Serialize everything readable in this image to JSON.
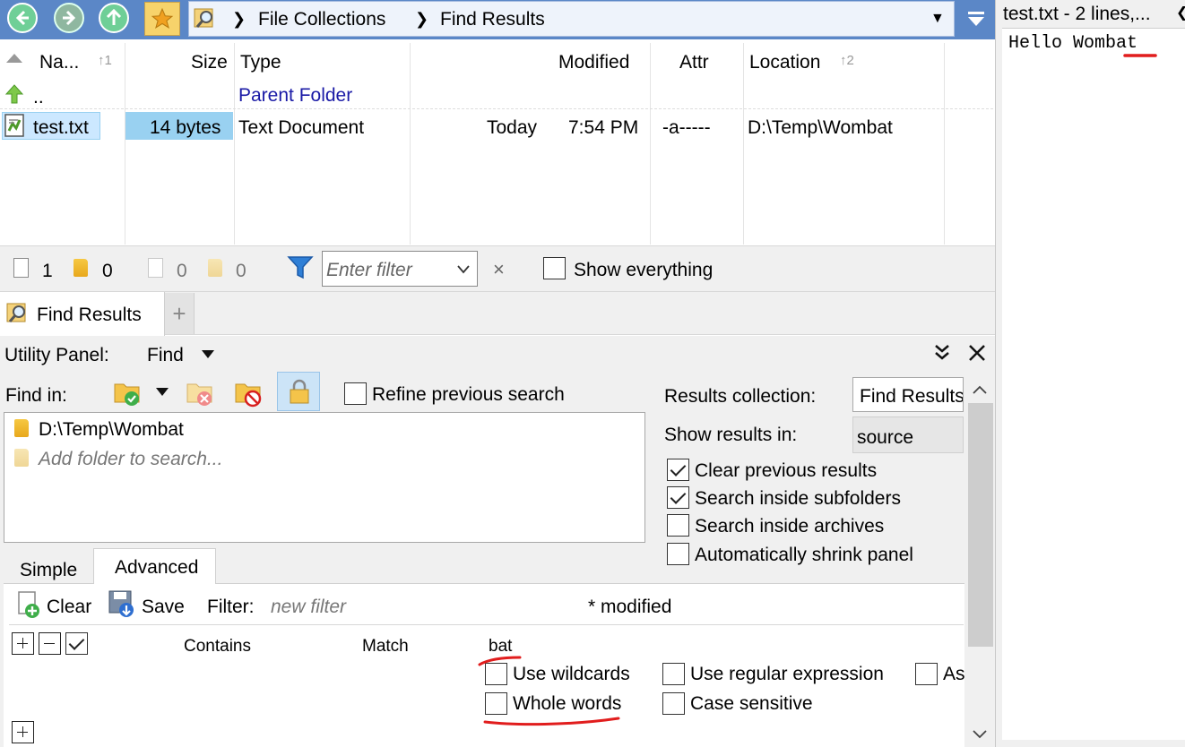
{
  "address_bar": {
    "crumbs": [
      "File Collections",
      "Find Results"
    ]
  },
  "file_list": {
    "columns": {
      "name": "Na...",
      "name_sort": "1",
      "size": "Size",
      "type": "Type",
      "modified": "Modified",
      "attr": "Attr",
      "location": "Location",
      "location_sort": "2"
    },
    "parent_row": {
      "name": "..",
      "type": "Parent Folder"
    },
    "rows": [
      {
        "name": "test.txt",
        "size": "14 bytes",
        "type": "Text Document",
        "modified_day": "Today",
        "modified_time": "7:54 PM",
        "attr": "-a-----",
        "location": "D:\\Temp\\Wombat"
      }
    ]
  },
  "status_bar": {
    "files_count": "1",
    "folders_count": "0",
    "sel_files_count": "0",
    "sel_folders_count": "0",
    "filter_placeholder": "Enter filter",
    "clear_filter": "×",
    "show_everything": "Show everything"
  },
  "tabs": {
    "active": "Find Results",
    "add": "+"
  },
  "utility_panel": {
    "label": "Utility Panel:",
    "selected": "Find",
    "find_in_label": "Find in:",
    "refine_previous": "Refine previous search",
    "folders": [
      "D:\\Temp\\Wombat"
    ],
    "add_folder_placeholder": "Add folder to search...",
    "results_collection_label": "Results collection:",
    "results_collection_value": "Find Results",
    "show_results_in_label": "Show results in:",
    "show_results_in_value": "source",
    "options": [
      {
        "label": "Clear previous results",
        "checked": true
      },
      {
        "label": "Search inside subfolders",
        "checked": true
      },
      {
        "label": "Search inside archives",
        "checked": false
      },
      {
        "label": "Automatically shrink panel",
        "checked": false
      }
    ],
    "subtabs": [
      "Simple",
      "Advanced"
    ],
    "active_subtab": "Advanced",
    "toolbar": {
      "clear": "Clear",
      "save": "Save",
      "filter_label": "Filter:",
      "filter_placeholder": "new filter",
      "modified": "* modified"
    },
    "criteria": {
      "field": "Contains",
      "operator": "Match",
      "value": "bat",
      "use_wildcards": "Use wildcards",
      "whole_words": "Whole words",
      "use_regex": "Use regular expression",
      "case_sensitive": "Case sensitive",
      "as_partial": "As"
    }
  },
  "preview": {
    "title": "test.txt - 2 lines,...",
    "content": "Hello Wombat"
  },
  "colors": {
    "toolbar_blue": "#5b87c7",
    "selection": "#cce8ff",
    "size_highlight": "#99d1f1",
    "link_blue": "#1a1aa6",
    "annotation_red": "#e11d1d",
    "panel_gray": "#f0f0f0"
  }
}
